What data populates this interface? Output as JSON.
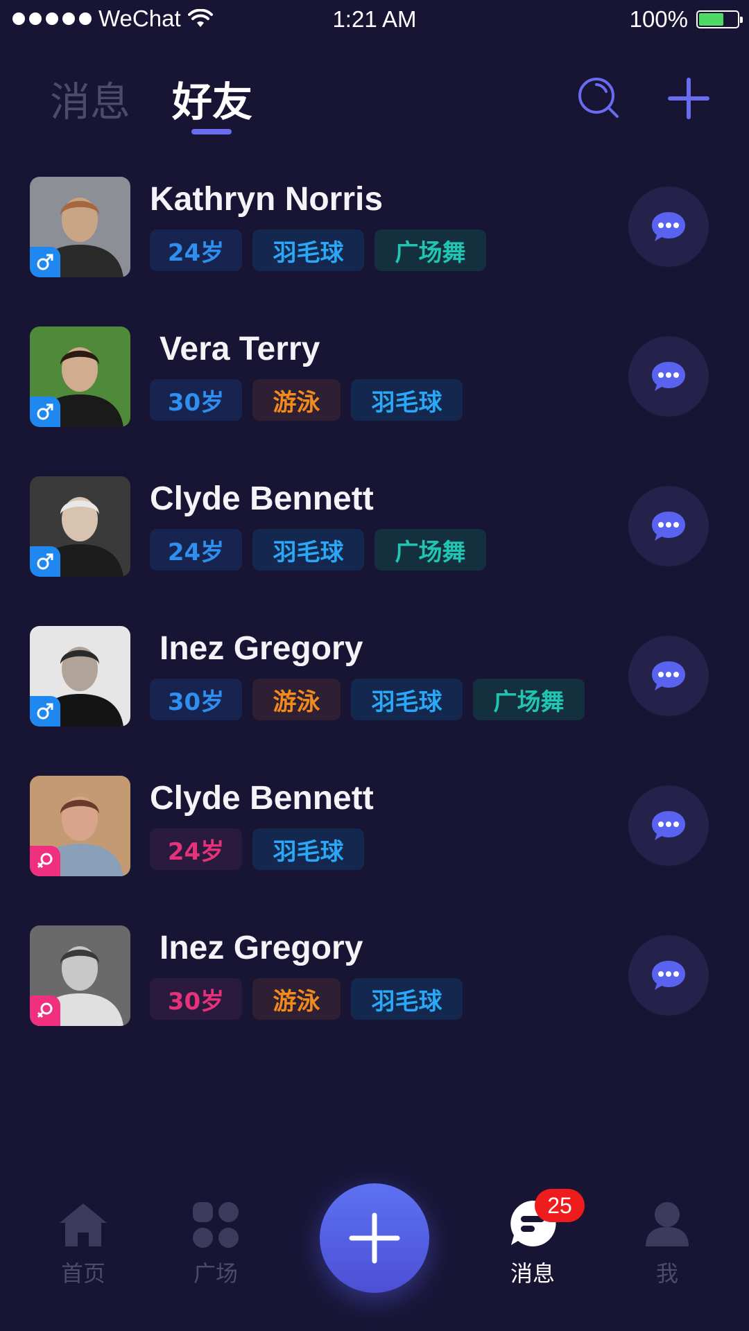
{
  "status_bar": {
    "carrier": "WeChat",
    "time": "1:21 AM",
    "battery_text": "100%",
    "battery_level": 1.0,
    "battery_color": "#4cd964"
  },
  "header": {
    "tabs": [
      {
        "label": "消息",
        "active": false
      },
      {
        "label": "好友",
        "active": true
      }
    ],
    "search_icon": "search-icon",
    "add_icon": "plus-icon",
    "accent": "#6a6cf0"
  },
  "tag_styles": {
    "age_male": {
      "bg": "#17244f",
      "fg": "#2f8ff0"
    },
    "age_female": {
      "bg": "#2a1a3e",
      "fg": "#e6327a"
    },
    "badminton": {
      "bg": "#14284f",
      "fg": "#2aa8f5"
    },
    "square_dance": {
      "bg": "#14303f",
      "fg": "#21c4b0"
    },
    "swimming": {
      "bg": "#2e1f33",
      "fg": "#f08a1e"
    }
  },
  "friends": [
    {
      "name": "Kathryn Norris",
      "gender": "male",
      "tags": [
        {
          "label": "24岁",
          "style": "age_male"
        },
        {
          "label": "羽毛球",
          "style": "badminton"
        },
        {
          "label": "广场舞",
          "style": "square_dance"
        }
      ]
    },
    {
      "name": "Vera Terry",
      "gender": "male",
      "tags": [
        {
          "label": "30岁",
          "style": "age_male"
        },
        {
          "label": "游泳",
          "style": "swimming"
        },
        {
          "label": "羽毛球",
          "style": "badminton"
        }
      ]
    },
    {
      "name": "Clyde Bennett",
      "gender": "male",
      "tags": [
        {
          "label": "24岁",
          "style": "age_male"
        },
        {
          "label": "羽毛球",
          "style": "badminton"
        },
        {
          "label": "广场舞",
          "style": "square_dance"
        }
      ]
    },
    {
      "name": "Inez Gregory",
      "gender": "male",
      "tags": [
        {
          "label": "30岁",
          "style": "age_male"
        },
        {
          "label": "游泳",
          "style": "swimming"
        },
        {
          "label": "羽毛球",
          "style": "badminton"
        },
        {
          "label": "广场舞",
          "style": "square_dance"
        }
      ]
    },
    {
      "name": "Clyde Bennett",
      "gender": "female",
      "tags": [
        {
          "label": "24岁",
          "style": "age_female"
        },
        {
          "label": "羽毛球",
          "style": "badminton"
        }
      ]
    },
    {
      "name": "Inez Gregory",
      "gender": "female",
      "tags": [
        {
          "label": "30岁",
          "style": "age_female"
        },
        {
          "label": "游泳",
          "style": "swimming"
        },
        {
          "label": "羽毛球",
          "style": "badminton"
        }
      ]
    }
  ],
  "gender_colors": {
    "male": "#1e88f0",
    "female": "#f0307f"
  },
  "chat_icon": "chat-bubble-icon",
  "bottom_nav": {
    "items": [
      {
        "label": "首页",
        "icon": "home-icon",
        "active": false
      },
      {
        "label": "广场",
        "icon": "grid-icon",
        "active": false
      },
      {
        "label": "消息",
        "icon": "message-icon",
        "active": true
      },
      {
        "label": "我",
        "icon": "user-icon",
        "active": false
      }
    ],
    "fab_icon": "plus-icon",
    "message_badge": "25"
  }
}
